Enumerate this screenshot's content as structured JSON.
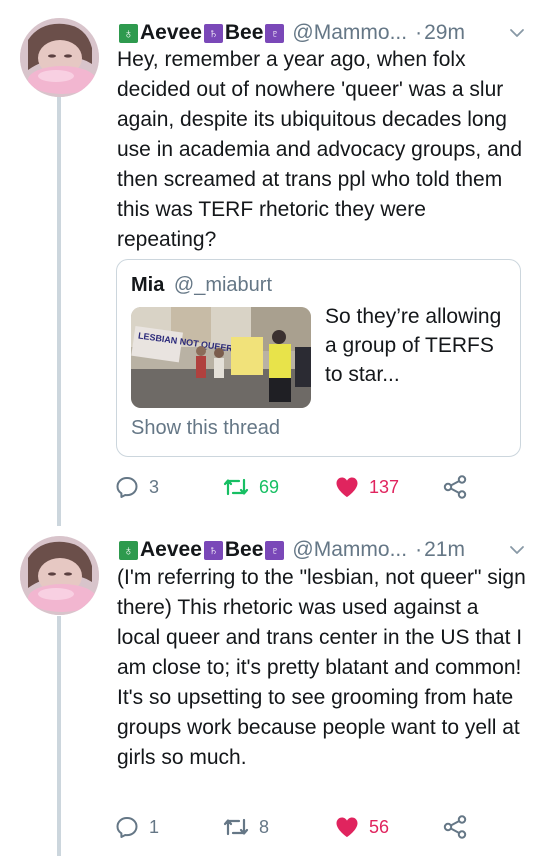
{
  "tweets": [
    {
      "display_name": "Aevee",
      "display_name_2": "Bee",
      "handle": "@Mammo...",
      "dot": "·",
      "time": "29m",
      "text": "Hey, remember a year ago, when folx decided out of nowhere 'queer' was a slur again, despite its ubiquitous decades long use in academia and advocacy groups, and then screamed at trans ppl who told them this was TERF rhetoric they were repeating?",
      "quote": {
        "name": "Mia",
        "handle": "@_miaburt",
        "text": "So they’re allowing a group of TERFS to star...",
        "show_thread": "Show this thread",
        "image_sign_text": "LESBIAN NOT QUEER"
      },
      "replies": "3",
      "retweets": "69",
      "likes": "137"
    },
    {
      "display_name": "Aevee",
      "display_name_2": "Bee",
      "handle": "@Mammo...",
      "dot": "·",
      "time": "21m",
      "text": "(I'm referring to the \"lesbian, not queer\" sign there) This rhetoric was used against a local queer and trans center in the US that I am close to; it's pretty blatant and common! It's so upsetting to see grooming from hate groups work because people want to yell at girls so much.",
      "replies": "1",
      "retweets": "8",
      "likes": "56"
    }
  ],
  "emoji": {
    "first": "♁",
    "second": "♄",
    "third": "♇"
  },
  "colors": {
    "secondary_text": "#657786",
    "retweet_green": "#17bf63",
    "like_red": "#e0245e",
    "border": "#ccd6dd"
  },
  "icons": [
    "reply-icon",
    "retweet-icon",
    "like-icon",
    "share-icon",
    "chevron-down-icon"
  ]
}
